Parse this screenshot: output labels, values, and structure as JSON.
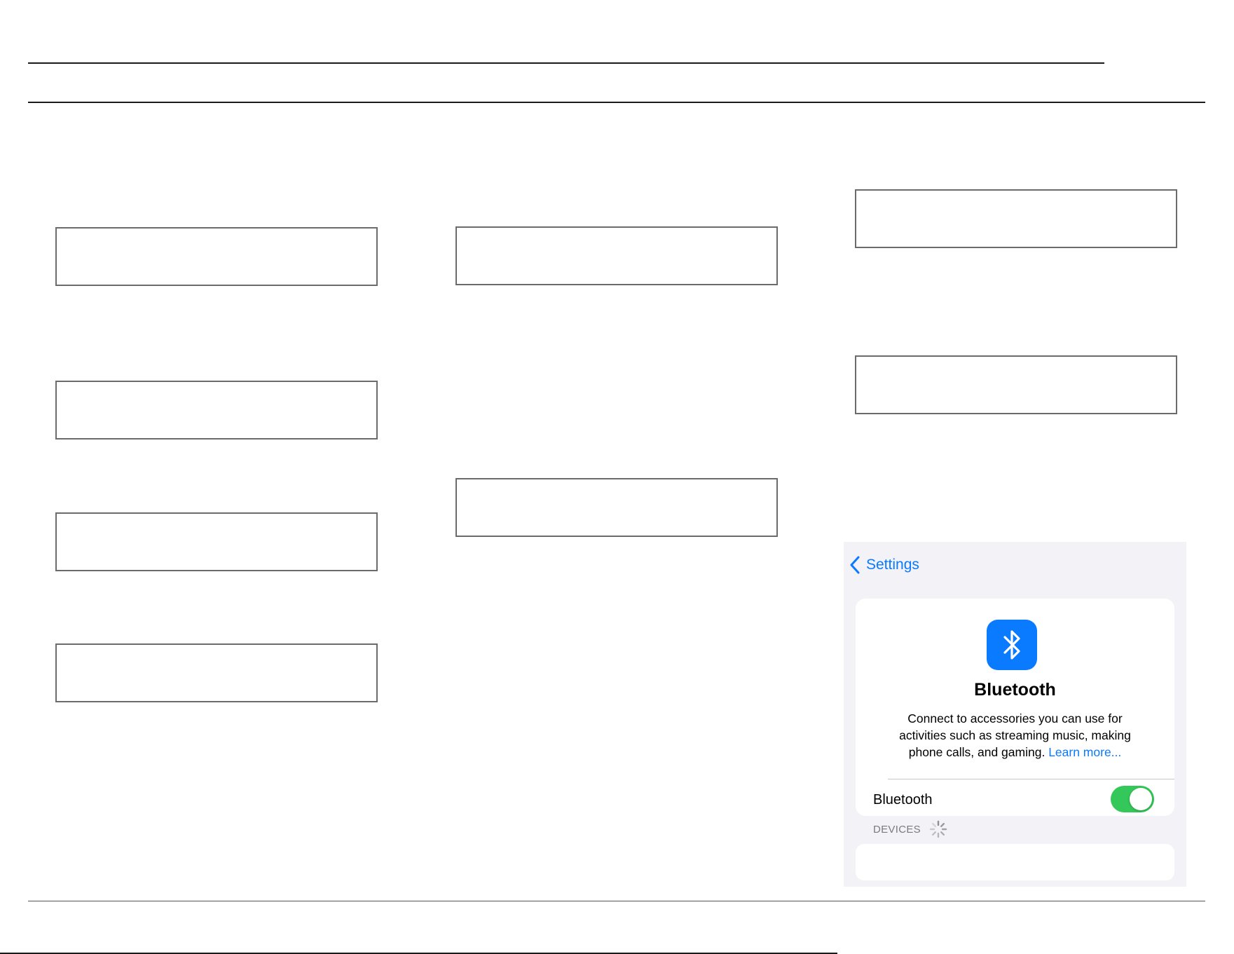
{
  "settings_panel": {
    "back_label": "Settings",
    "header": {
      "icon": "bluetooth-icon",
      "title": "Bluetooth",
      "description": "Connect to accessories you can use for activities such as streaming music, making phone calls, and gaming. ",
      "learn_more": "Learn more..."
    },
    "bluetooth_row": {
      "label": "Bluetooth",
      "enabled": true
    },
    "devices_section": {
      "header": "DEVICES",
      "loading": true
    }
  },
  "colors": {
    "accent": "#0a7aff",
    "toggle_on": "#34c759",
    "panel_background": "#f2f2f7",
    "secondary_text": "#7a7a7f"
  }
}
